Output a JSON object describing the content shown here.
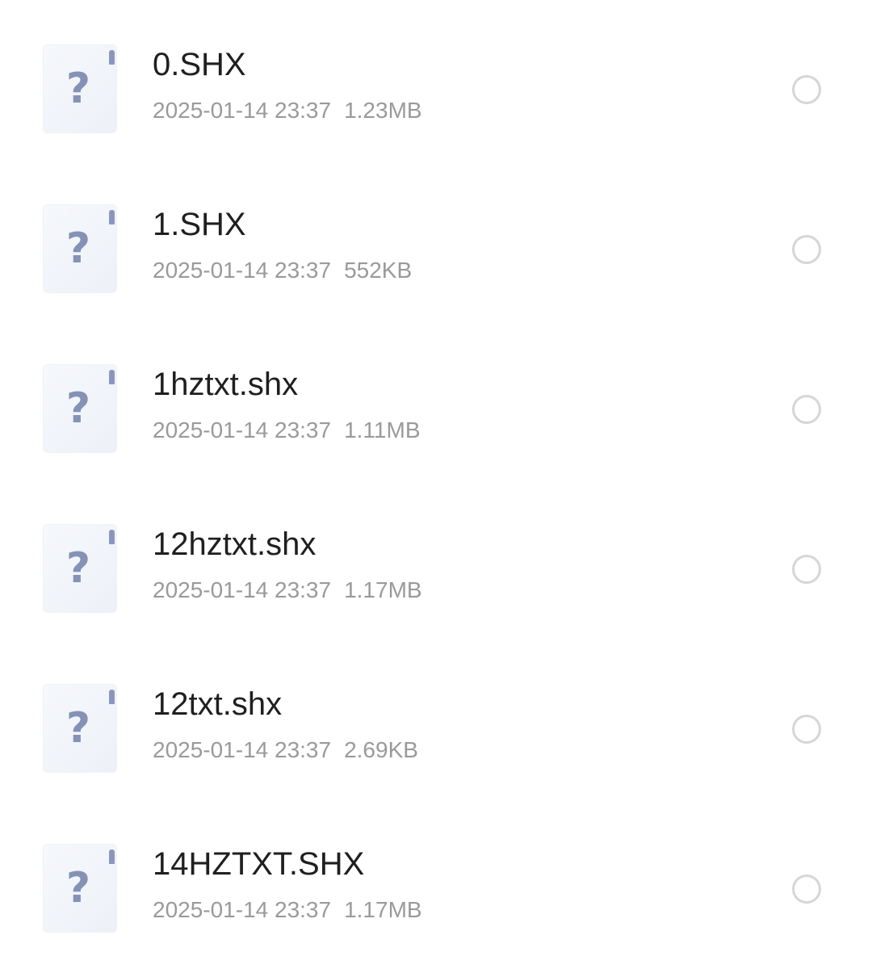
{
  "files": [
    {
      "name": "0.SHX",
      "date": "2025-01-14 23:37",
      "size": "1.23MB",
      "icon": "unknown-file-icon",
      "selected": false
    },
    {
      "name": "1.SHX",
      "date": "2025-01-14 23:37",
      "size": "552KB",
      "icon": "unknown-file-icon",
      "selected": false
    },
    {
      "name": "1hztxt.shx",
      "date": "2025-01-14 23:37",
      "size": "1.11MB",
      "icon": "unknown-file-icon",
      "selected": false
    },
    {
      "name": "12hztxt.shx",
      "date": "2025-01-14 23:37",
      "size": "1.17MB",
      "icon": "unknown-file-icon",
      "selected": false
    },
    {
      "name": "12txt.shx",
      "date": "2025-01-14 23:37",
      "size": "2.69KB",
      "icon": "unknown-file-icon",
      "selected": false
    },
    {
      "name": "14HZTXT.SHX",
      "date": "2025-01-14 23:37",
      "size": "1.17MB",
      "icon": "unknown-file-icon",
      "selected": false
    }
  ],
  "icon_glyph": "?",
  "colors": {
    "file_name": "#1f1f1f",
    "meta_text": "#9a9a9a",
    "icon_bg": "#f1f4f9",
    "icon_glyph": "#8592b5",
    "radio_border": "#d6d6d6"
  }
}
